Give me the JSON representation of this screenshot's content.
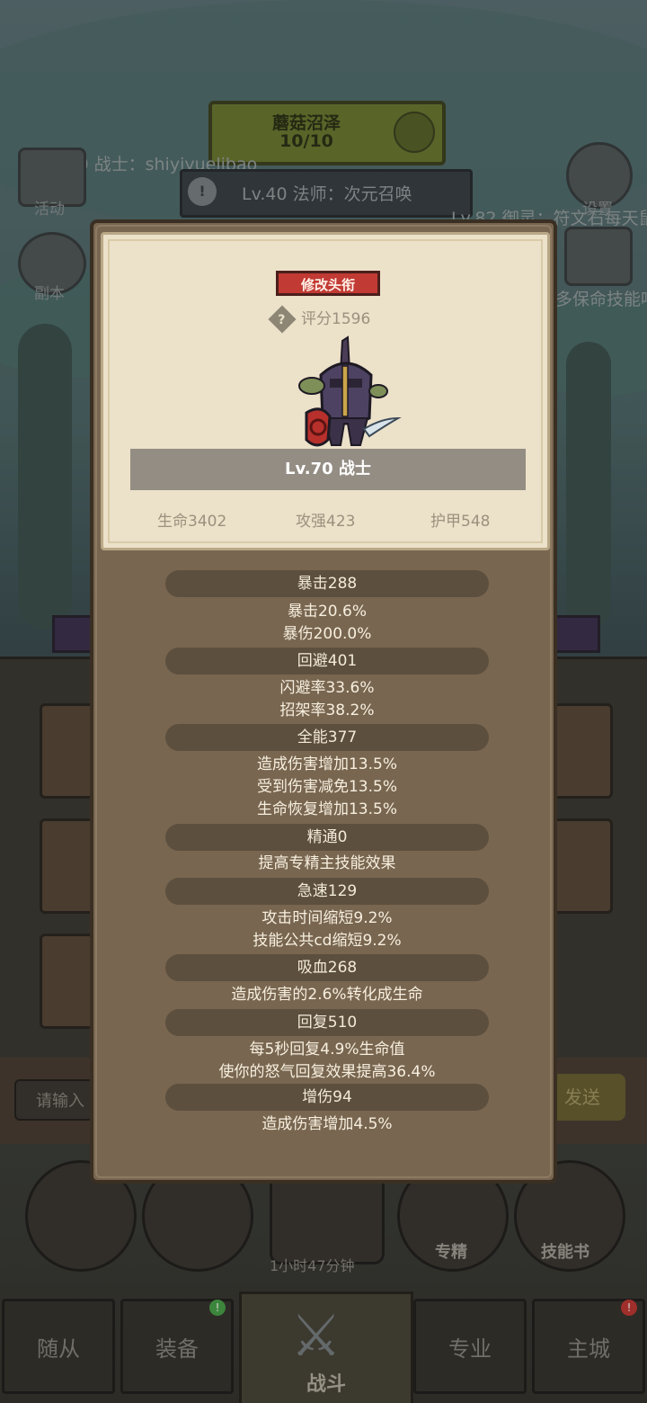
{
  "background": {
    "top_banner": {
      "name": "蘑菇沼泽",
      "progress": "10/10"
    },
    "chat_line_1": "Lv.70 战士：shiyiyuelibao",
    "info_text": "Lv.40 法师：次元召唤",
    "chat_line_2": "Lv.82 御灵：符文石每天鼠",
    "chat_line_3": "多保命技能吗",
    "left_menu": [
      {
        "label": "活动"
      },
      {
        "label": "副本"
      }
    ],
    "right_menu": [
      {
        "label": "设置"
      }
    ],
    "input_placeholder": "请输入",
    "send_label": "发送",
    "timer": "1小时47分钟",
    "circles": [
      {
        "label": ""
      },
      {
        "label": ""
      },
      {
        "label": "专精"
      },
      {
        "label": "技能书"
      }
    ],
    "tabs": [
      {
        "label": "随从",
        "badge": ""
      },
      {
        "label": "装备",
        "badge": "!"
      },
      {
        "label": "战斗",
        "badge": ""
      },
      {
        "label": "专业",
        "badge": ""
      },
      {
        "label": "主城",
        "badge": "!"
      }
    ]
  },
  "modal": {
    "title_button": "修改头衔",
    "score": "评分1596",
    "hero_name": "Lv.70 战士",
    "base_stats": [
      "生命3402",
      "攻强423",
      "护甲548"
    ],
    "stat_groups": [
      {
        "header": "暴击288",
        "lines": [
          "暴击20.6%",
          "暴伤200.0%"
        ]
      },
      {
        "header": "回避401",
        "lines": [
          "闪避率33.6%",
          "招架率38.2%"
        ]
      },
      {
        "header": "全能377",
        "lines": [
          "造成伤害增加13.5%",
          "受到伤害减免13.5%",
          "生命恢复增加13.5%"
        ]
      },
      {
        "header": "精通0",
        "lines": [
          "提高专精主技能效果"
        ]
      },
      {
        "header": "急速129",
        "lines": [
          "攻击时间缩短9.2%",
          "技能公共cd缩短9.2%"
        ]
      },
      {
        "header": "吸血268",
        "lines": [
          "造成伤害的2.6%转化成生命"
        ]
      },
      {
        "header": "回复510",
        "lines": [
          "每5秒回复4.9%生命值",
          "使你的怒气回复效果提高36.4%"
        ]
      },
      {
        "header": "增伤94",
        "lines": [
          "造成伤害增加4.5%"
        ]
      }
    ]
  },
  "colors": {
    "accent_red": "#c23a34",
    "badge_green": "#4aa34a",
    "badge_red": "#c23a34"
  }
}
